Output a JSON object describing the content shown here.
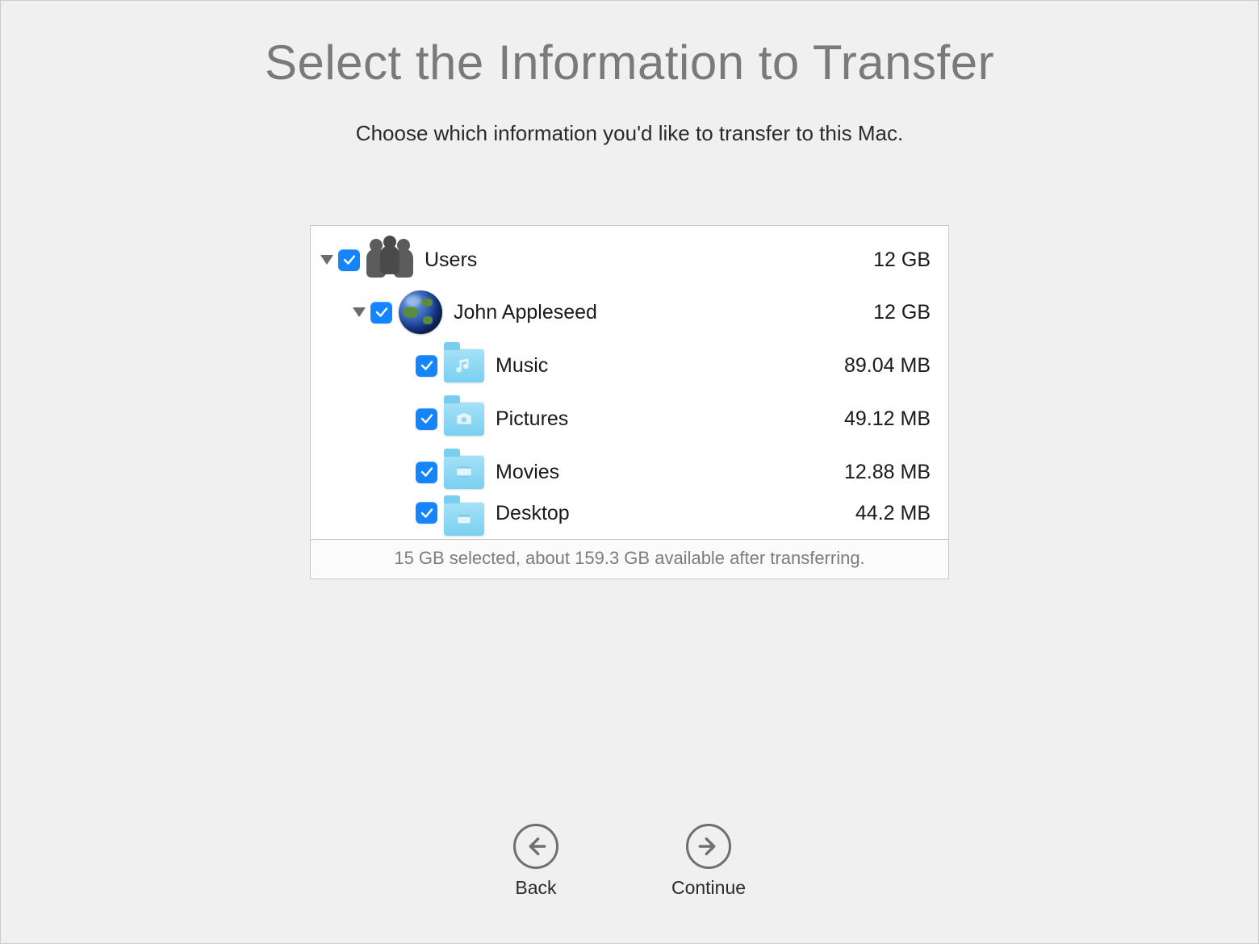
{
  "title": "Select the Information to Transfer",
  "subtitle": "Choose which information you'd like to transfer to this Mac.",
  "tree": {
    "users": {
      "label": "Users",
      "size": "12 GB"
    },
    "user": {
      "label": "John Appleseed",
      "size": "12 GB"
    },
    "items": [
      {
        "label": "Music",
        "size": "89.04 MB",
        "icon": "music"
      },
      {
        "label": "Pictures",
        "size": "49.12 MB",
        "icon": "camera"
      },
      {
        "label": "Movies",
        "size": "12.88 MB",
        "icon": "film"
      },
      {
        "label": "Desktop",
        "size": "44.2 MB",
        "icon": "window"
      }
    ]
  },
  "footer": "15 GB selected, about 159.3 GB available after transferring.",
  "nav": {
    "back": "Back",
    "continue": "Continue"
  }
}
